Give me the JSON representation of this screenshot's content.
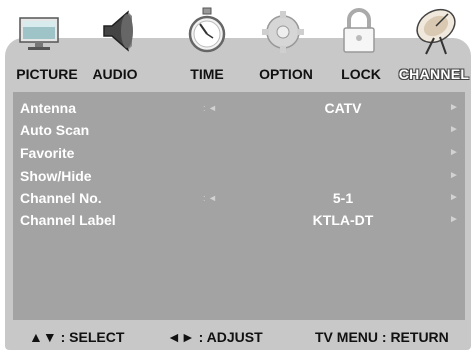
{
  "tabs": [
    {
      "label": "PICTURE",
      "icon": "monitor-icon"
    },
    {
      "label": "AUDIO",
      "icon": "speaker-icon"
    },
    {
      "label": "TIME",
      "icon": "stopwatch-icon"
    },
    {
      "label": "OPTION",
      "icon": "gear-icon"
    },
    {
      "label": "LOCK",
      "icon": "padlock-icon"
    },
    {
      "label": "CHANNEL",
      "icon": "satellite-dish-icon",
      "active": true
    }
  ],
  "menu": [
    {
      "label": "Antenna",
      "separator": ": ◄",
      "value": "CATV",
      "arrow": "►"
    },
    {
      "label": "Auto Scan",
      "separator": "",
      "value": "",
      "arrow": "►"
    },
    {
      "label": "Favorite",
      "separator": "",
      "value": "",
      "arrow": "►"
    },
    {
      "label": "Show/Hide",
      "separator": "",
      "value": "",
      "arrow": "►"
    },
    {
      "label": "Channel No.",
      "separator": ": ◄",
      "value": "5-1",
      "arrow": "►"
    },
    {
      "label": "Channel Label",
      "separator": "",
      "value": "KTLA-DT",
      "arrow": "►"
    }
  ],
  "footer": {
    "select": "▲▼ : SELECT",
    "adjust": "◄► : ADJUST",
    "return": "TV MENU : RETURN"
  },
  "colors": {
    "frame": "#c8c8c8",
    "panel": "#a3a3a3",
    "text": "#ffffff",
    "arrows": "#d2d2d2"
  }
}
